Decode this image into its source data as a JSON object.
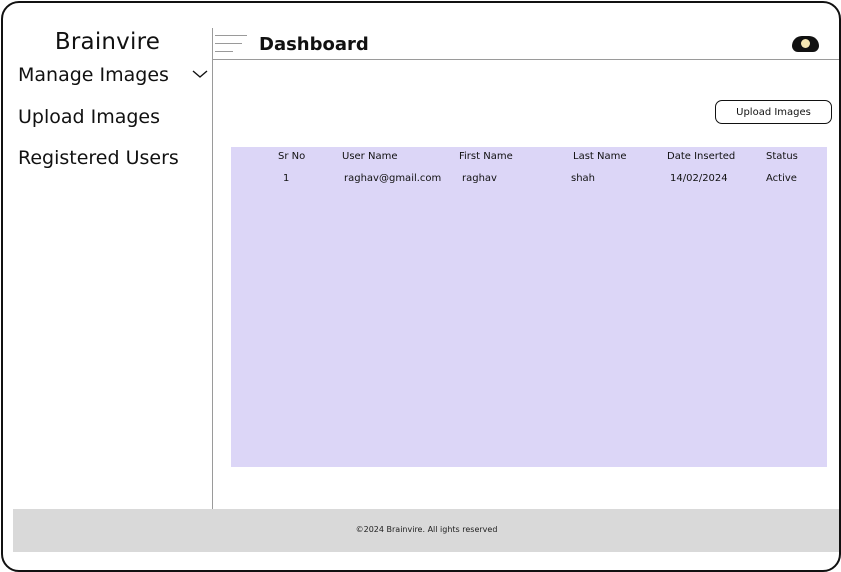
{
  "sidebar": {
    "brand": "Brainvire",
    "items": [
      {
        "label": "Manage Images"
      },
      {
        "label": "Upload Images"
      },
      {
        "label": "Registered Users"
      }
    ]
  },
  "header": {
    "title": "Dashboard"
  },
  "toolbar": {
    "upload_label": "Upload Images"
  },
  "table": {
    "columns": [
      "Sr No",
      "User Name",
      "First Name",
      "Last Name",
      "Date Inserted",
      "Status"
    ],
    "rows": [
      [
        "1",
        "raghav@gmail.com",
        "raghav",
        "shah",
        "14/02/2024",
        "Active"
      ]
    ]
  },
  "footer": {
    "text": "©2024 Brainvire. All ights reserved"
  },
  "icons": {
    "menu": "hamburger-menu-icon",
    "chevron": "chevron-down-icon",
    "user": "user-avatar-icon"
  },
  "colors": {
    "table_background": "#dcd6f7",
    "footer_background": "#d9d9d9"
  }
}
